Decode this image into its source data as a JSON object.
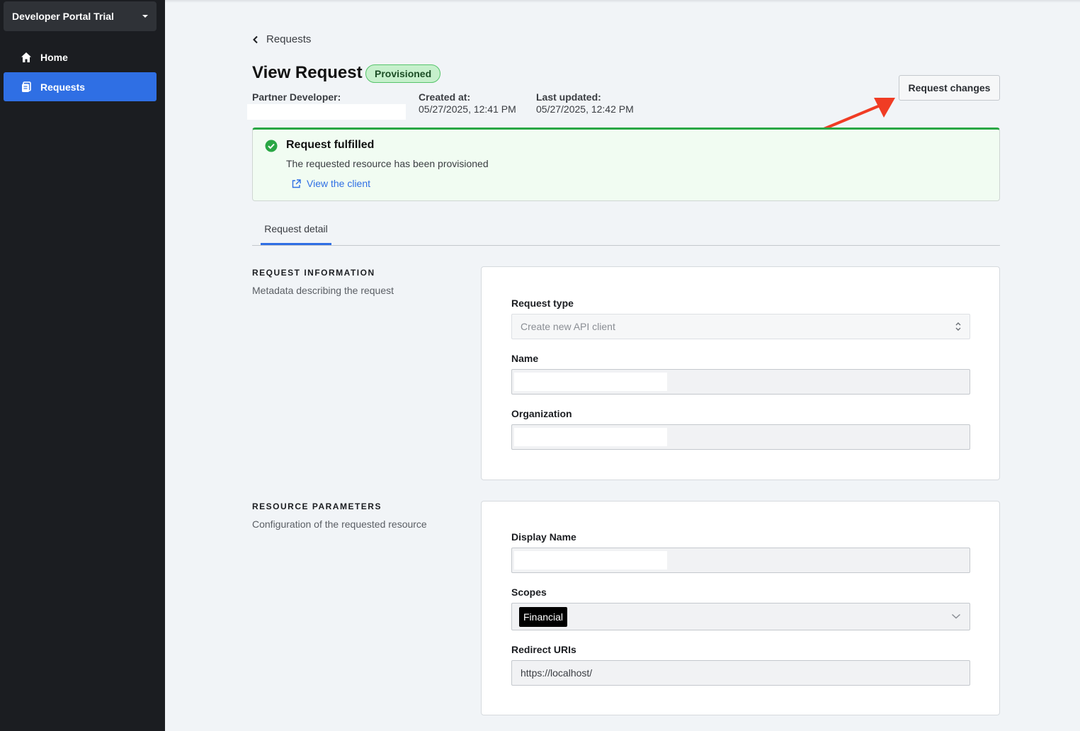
{
  "sidebar": {
    "portal_name": "Developer Portal Trial",
    "items": [
      {
        "label": "Home",
        "icon": "home-icon"
      },
      {
        "label": "Requests",
        "icon": "requests-icon"
      }
    ]
  },
  "header": {
    "back_label": "Requests",
    "title": "View Request",
    "status": "Provisioned",
    "partner_label": "Partner Developer:",
    "created_label": "Created at:",
    "created_value": "05/27/2025, 12:41 PM",
    "updated_label": "Last updated:",
    "updated_value": "05/27/2025, 12:42 PM",
    "request_changes_label": "Request changes"
  },
  "success": {
    "title": "Request fulfilled",
    "description": "The requested resource has been provisioned",
    "link_label": "View the client"
  },
  "tabs": [
    {
      "label": "Request detail",
      "active": true
    }
  ],
  "request_info": {
    "title": "REQUEST INFORMATION",
    "description": "Metadata describing the request",
    "request_type_label": "Request type",
    "request_type_value": "Create new API client",
    "name_label": "Name",
    "organization_label": "Organization"
  },
  "resource_params": {
    "title": "RESOURCE PARAMETERS",
    "description": "Configuration of the requested resource",
    "display_name_label": "Display Name",
    "scopes_label": "Scopes",
    "scopes": [
      "Financial"
    ],
    "redirect_label": "Redirect URIs",
    "redirect_value": "https://localhost/"
  },
  "colors": {
    "accent": "#2f6fe4",
    "success": "#2aa745",
    "arrow": "#f03c24"
  }
}
